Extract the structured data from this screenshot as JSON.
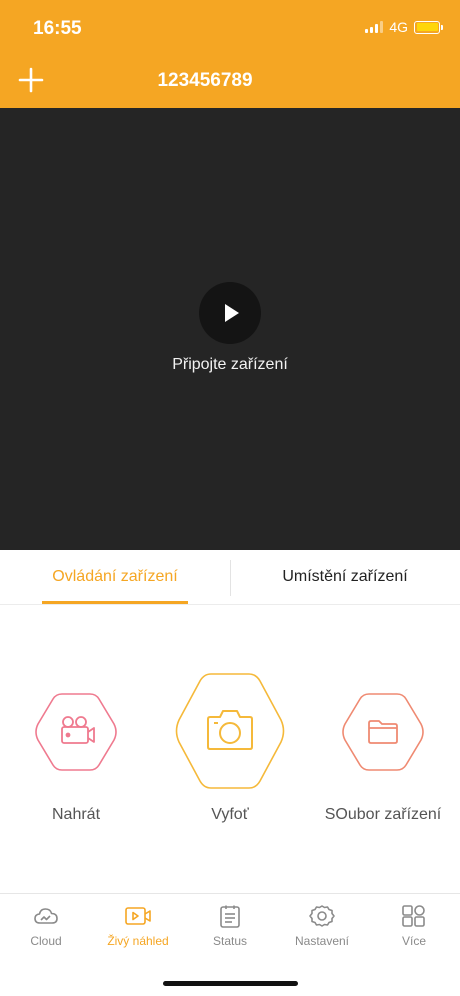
{
  "status_bar": {
    "time": "16:55",
    "network": "4G"
  },
  "nav": {
    "title": "123456789",
    "add_icon": "plus-icon"
  },
  "video": {
    "message": "Připojte zařízení",
    "play_icon": "play-icon"
  },
  "tabs": [
    {
      "label": "Ovládání zařízení",
      "active": true
    },
    {
      "label": "Umístění zařízení",
      "active": false
    }
  ],
  "actions": [
    {
      "label": "Nahrát",
      "icon": "video-camera-icon",
      "color": "#ef7a8f"
    },
    {
      "label": "Vyfoť",
      "icon": "camera-icon",
      "color": "#f5b93a"
    },
    {
      "label": "SOubor zařízení",
      "icon": "folder-icon",
      "color": "#ef8a72"
    }
  ],
  "tabbar": [
    {
      "label": "Cloud",
      "icon": "cloud-icon",
      "active": false
    },
    {
      "label": "Živý náhled",
      "icon": "live-video-icon",
      "active": true
    },
    {
      "label": "Status",
      "icon": "clipboard-icon",
      "active": false
    },
    {
      "label": "Nastavení",
      "icon": "gear-icon",
      "active": false
    },
    {
      "label": "Více",
      "icon": "grid-icon",
      "active": false
    }
  ],
  "colors": {
    "accent": "#f5a623",
    "video_bg": "#252525",
    "text_dark": "#222222",
    "text_muted": "#8a8a8a"
  }
}
